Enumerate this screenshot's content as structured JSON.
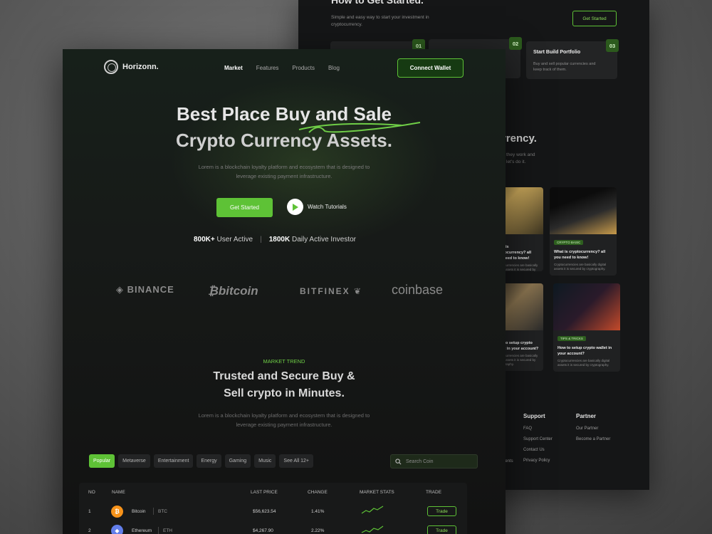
{
  "back": {
    "title": "How to Get Started.",
    "subtitle": "Simple and easy way to start your investment in cryptocurrency.",
    "get_started": "Get Started",
    "steps": [
      {
        "num": "01",
        "title": "",
        "desc": ""
      },
      {
        "num": "02",
        "title": "",
        "desc": ""
      },
      {
        "num": "03",
        "title": "Start Build Portfolio",
        "desc": "Buy and sell popular currencies and keep track of them."
      }
    ],
    "section_title": "rrency.",
    "section_sub": [
      "they work and",
      "let's do it."
    ],
    "cards": [
      {
        "tag": "",
        "title": "What is cryptocurrency? all you need to know!",
        "desc": "Cryptocurrencies are basically digital assets it is secured by cryptography."
      },
      {
        "tag": "CRYPTO BASIC",
        "title": "What is cryptocurrency? all you need to know!",
        "desc": "Cryptocurrencies are basically digital assets it is secured by cryptography."
      },
      {
        "tag": "",
        "title": "How to setup crypto wallet in your account?",
        "desc": "Cryptocurrencies are basically digital assets it is secured by cryptography."
      },
      {
        "tag": "TIPS & TRICKS",
        "title": "How to setup crypto wallet in your account?",
        "desc": "Cryptocurrencies are basically digital assets it is secured by cryptography."
      }
    ],
    "footer": {
      "support": {
        "heading": "Support",
        "links": [
          "FAQ",
          "Support Center",
          "Contact Us",
          "Privacy Policy"
        ]
      },
      "partner": {
        "heading": "Partner",
        "links": [
          "Our Partner",
          "Become a Partner"
        ]
      },
      "partial": [
        "n?",
        "ements"
      ]
    }
  },
  "front": {
    "logo": "Horizonn.",
    "nav": [
      "Market",
      "Features",
      "Products",
      "Blog"
    ],
    "connect": "Connect Wallet",
    "hero_line1": "Best Place Buy and Sale",
    "hero_line2": "Crypto Currency Assets.",
    "hero_sub": "Lorem is a blockchain loyalty platform and ecosystem that is designed to leverage existing payment infrastructure.",
    "get_started": "Get Started",
    "watch": "Watch Tutorials",
    "stats": [
      {
        "value": "800K+",
        "label": "User Active"
      },
      {
        "value": "1800K",
        "label": "Daily Active Investor"
      }
    ],
    "brands": [
      "BINANCE",
      "bitcoin",
      "BITFINEX",
      "coinbase"
    ],
    "market_label": "MARKET TREND",
    "trend_line1": "Trusted and Secure Buy &",
    "trend_line2": "Sell crypto in Minutes.",
    "trend_sub": "Lorem is a blockchain loyalty platform and ecosystem that is designed to leverage existing payment infrastructure.",
    "tabs": [
      "Popular",
      "Metaverse",
      "Entertainment",
      "Energy",
      "Gaming",
      "Music",
      "See All 12+"
    ],
    "search_placeholder": "Search Coin",
    "table": {
      "headers": [
        "NO",
        "NAME",
        "LAST PRICE",
        "CHANGE",
        "MARKET STATS",
        "TRADE"
      ],
      "rows": [
        {
          "no": "1",
          "name": "Bitcoin",
          "symbol": "BTC",
          "price": "$56,623.54",
          "change": "1.41%",
          "trade": "Trade",
          "color": "#f7931a"
        },
        {
          "no": "2",
          "name": "Ethereum",
          "symbol": "ETH",
          "price": "$4,267.90",
          "change": "2.22%",
          "trade": "Trade",
          "color": "#627eea"
        }
      ]
    }
  }
}
